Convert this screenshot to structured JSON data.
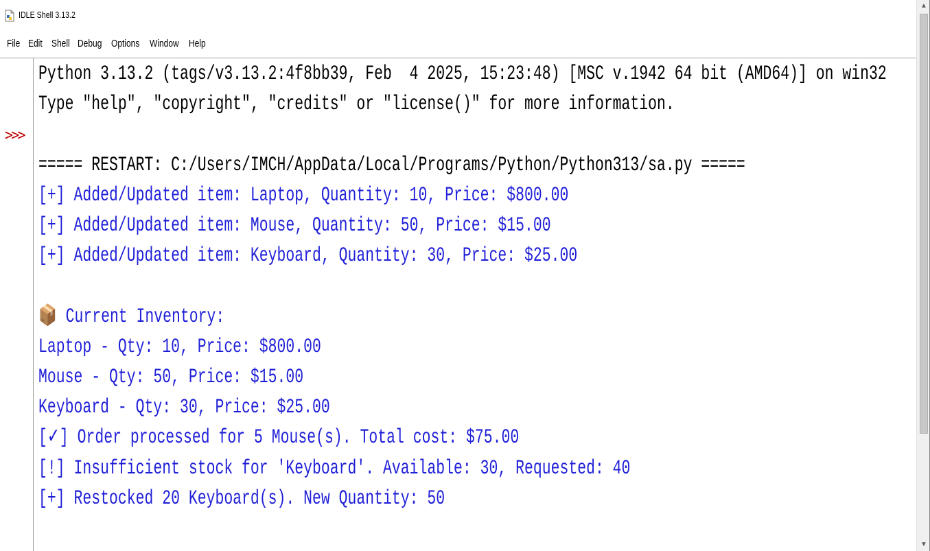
{
  "window": {
    "title": "IDLE Shell 3.13.2",
    "icon": "python-file-icon"
  },
  "menu": {
    "items": [
      "File",
      "Edit",
      "Shell",
      "Debug",
      "Options",
      "Window",
      "Help"
    ]
  },
  "shell": {
    "prompt": ">>>",
    "lines": [
      {
        "text": "Python 3.13.2 (tags/v3.13.2:4f8bb39, Feb  4 2025, 15:23:48) [MSC v.1942 64 bit (AMD64)] on win32",
        "color": "#000000"
      },
      {
        "text": "Type \"help\", \"copyright\", \"credits\" or \"license()\" for more information.",
        "color": "#000000"
      },
      {
        "text": "",
        "color": "#000000"
      },
      {
        "text": "===== RESTART: C:/Users/IMCH/AppData/Local/Programs/Python/Python313/sa.py =====",
        "color": "#000000"
      },
      {
        "text": "[+] Added/Updated item: Laptop, Quantity: 10, Price: $800.00",
        "color": "#1f1fd8"
      },
      {
        "text": "[+] Added/Updated item: Mouse, Quantity: 50, Price: $15.00",
        "color": "#1f1fd8"
      },
      {
        "text": "[+] Added/Updated item: Keyboard, Quantity: 30, Price: $25.00",
        "color": "#1f1fd8"
      },
      {
        "text": "",
        "color": "#1f1fd8"
      },
      {
        "text": "📦 Current Inventory:",
        "color": "#1f1fd8"
      },
      {
        "text": "Laptop - Qty: 10, Price: $800.00",
        "color": "#1f1fd8"
      },
      {
        "text": "Mouse - Qty: 50, Price: $15.00",
        "color": "#1f1fd8"
      },
      {
        "text": "Keyboard - Qty: 30, Price: $25.00",
        "color": "#1f1fd8"
      },
      {
        "text": "[✓] Order processed for 5 Mouse(s). Total cost: $75.00",
        "color": "#1f1fd8"
      },
      {
        "text": "[!] Insufficient stock for 'Keyboard'. Available: 30, Requested: 40",
        "color": "#1f1fd8"
      },
      {
        "text": "[+] Restocked 20 Keyboard(s). New Quantity: 50",
        "color": "#1f1fd8"
      }
    ]
  },
  "colors": {
    "stdout": "#1f1fd8",
    "banner": "#000000",
    "prompt": "#c00000"
  }
}
